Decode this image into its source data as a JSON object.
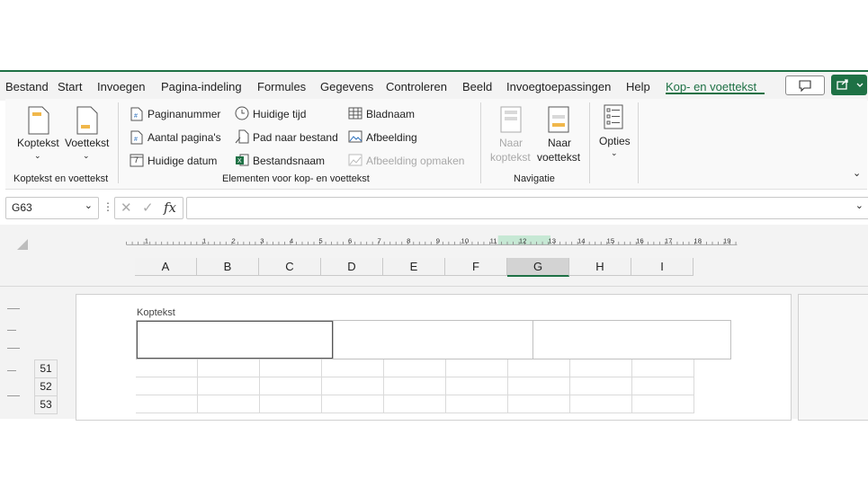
{
  "menu": {
    "tabs": [
      "Bestand",
      "Start",
      "Invoegen",
      "Pagina-indeling",
      "Formules",
      "Gegevens",
      "Controleren",
      "Beeld",
      "Invoegtoepassingen",
      "Help",
      "Kop- en voettekst"
    ],
    "active_tab": "Kop- en voettekst"
  },
  "ribbon": {
    "group1": {
      "label": "Koptekst en voettekst",
      "koptekst": "Koptekst",
      "voettekst": "Voettekst"
    },
    "group2": {
      "label": "Elementen voor kop- en voettekst",
      "paginanummer": "Paginanummer",
      "aantal_paginas": "Aantal pagina's",
      "huidige_datum": "Huidige datum",
      "huidige_tijd": "Huidige tijd",
      "pad_naar_bestand": "Pad naar bestand",
      "bestandsnaam": "Bestandsnaam",
      "bladnaam": "Bladnaam",
      "afbeelding": "Afbeelding",
      "afbeelding_opmaken": "Afbeelding opmaken",
      "date_icon_digit": "7"
    },
    "group3": {
      "label": "Navigatie",
      "naar_koptekst_1": "Naar",
      "naar_koptekst_2": "koptekst",
      "naar_voettekst_1": "Naar",
      "naar_voettekst_2": "voettekst"
    },
    "group4": {
      "opties": "Opties"
    }
  },
  "formula": {
    "namebox": "G63",
    "fx": "fx",
    "value": ""
  },
  "ruler": {
    "ticks": [
      "1",
      "1",
      "2",
      "3",
      "4",
      "5",
      "6",
      "7",
      "8",
      "9",
      "10",
      "11",
      "12",
      "13",
      "14",
      "15",
      "16",
      "17",
      "18",
      "19"
    ]
  },
  "columns": [
    "A",
    "B",
    "C",
    "D",
    "E",
    "F",
    "G",
    "H",
    "I"
  ],
  "selected_column": "G",
  "header_label": "Koptekst",
  "rows": [
    "51",
    "52",
    "53"
  ],
  "colors": {
    "accent": "#1e7145",
    "selected_col": "#d3d3d3",
    "ruler_highlight": "#c6e8d4"
  }
}
